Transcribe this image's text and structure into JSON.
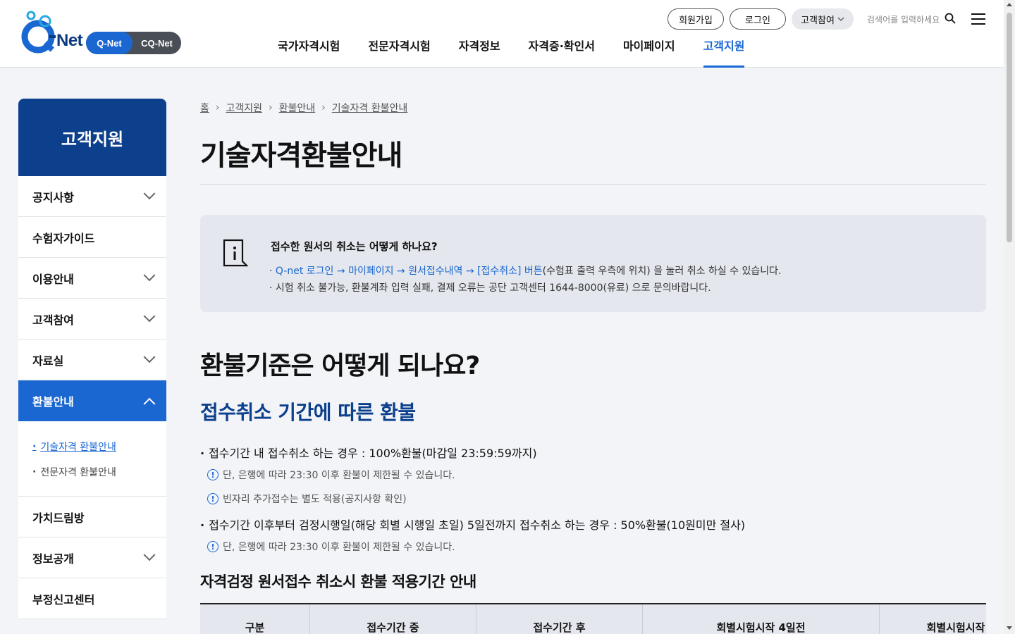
{
  "header": {
    "logo_text": "Q-Net",
    "switch": {
      "qnet": "Q-Net",
      "cqnet": "CQ-Net"
    },
    "util": {
      "join": "회원가입",
      "login": "로그인",
      "customer": "고객참여"
    },
    "search_placeholder": "검색어를 입력하세요",
    "gnb": [
      "국가자격시험",
      "전문자격시험",
      "자격정보",
      "자격증·확인서",
      "마이페이지",
      "고객지원"
    ],
    "gnb_active_index": 5
  },
  "sidebar": {
    "title": "고객지원",
    "items": [
      {
        "label": "공지사항",
        "expandable": true
      },
      {
        "label": "수험자가이드",
        "expandable": false
      },
      {
        "label": "이용안내",
        "expandable": true
      },
      {
        "label": "고객참여",
        "expandable": true
      },
      {
        "label": "자료실",
        "expandable": true
      },
      {
        "label": "환불안내",
        "expandable": true,
        "active": true
      },
      {
        "label": "가치드림방",
        "expandable": false
      },
      {
        "label": "정보공개",
        "expandable": true
      },
      {
        "label": "부정신고센터",
        "expandable": false
      }
    ],
    "sub_items": [
      "기술자격 환불안내",
      "전문자격 환불안내"
    ]
  },
  "main": {
    "breadcrumb": [
      "홈",
      "고객지원",
      "환불안내",
      "기술자격 환불안내"
    ],
    "title": "기술자격환불안내",
    "info": {
      "title": "접수한 원서의 취소는 어떻게 하나요?",
      "line1_link": "Q-net 로그인 → 마이페이지 → 원서접수내역 → [접수취소] 버튼",
      "line1_rest": "(수험표 출력 우측에 위치) 을 눌러 취소 하실 수 있습니다.",
      "line2": "시험 취소 불가능, 환불계좌 입력 실패, 결제 오류는 공단 고객센터 1644-8000(유료) 으로 문의바랍니다."
    },
    "h2": "환불기준은 어떻게 되나요?",
    "h3": "접수취소 기간에 따른 환불",
    "bullets": [
      "접수기간 내 접수취소 하는 경우 : 100%환불(마감일 23:59:59까지)",
      "접수기간 이후부터 검정시행일(해당 회별 시행일 초일) 5일전까지 접수취소 하는 경우 : 50%환불(10원미만 절사)"
    ],
    "notes": [
      "단, 은행에 따라 23:30 이후 환불이 제한될 수 있습니다.",
      "빈자리 추가접수는 별도 적용(공지사항 확인)",
      "단, 은행에 따라 23:30 이후 환불이 제한될 수 있습니다."
    ],
    "h4": "자격검정 원서접수 취소시 환불 적용기간 안내",
    "table_headers": [
      "구분",
      "접수기간 중",
      "접수기간 후",
      "회별시험시작 4일전",
      "회별시험시작"
    ]
  }
}
